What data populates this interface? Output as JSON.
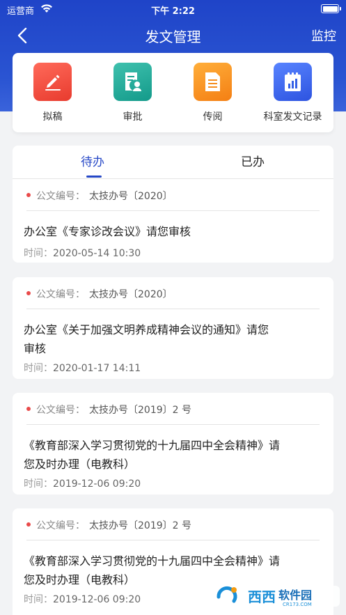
{
  "status_bar": {
    "carrier": "运营商",
    "time": "下午 2:22"
  },
  "nav": {
    "title": "发文管理",
    "right_action": "监控"
  },
  "actions": [
    {
      "label": "拟稿",
      "icon": "pencil-icon",
      "color": "#e83b2e"
    },
    {
      "label": "审批",
      "icon": "approval-icon",
      "color": "#139a8a"
    },
    {
      "label": "传阅",
      "icon": "document-icon",
      "color": "#f47f13"
    },
    {
      "label": "科室发文记录",
      "icon": "chart-record-icon",
      "color": "#2d53e0"
    }
  ],
  "tabs": {
    "pending": "待办",
    "done": "已办",
    "active": "pending"
  },
  "doc_labels": {
    "number_label": "公文编号：",
    "time_label": "时间："
  },
  "documents": [
    {
      "number": "太技办号〔2020〕",
      "title_line1": "办公室《专家诊改会议》请您审核",
      "title_line2": "",
      "time": "2020-05-14 10:30"
    },
    {
      "number": "太技办号〔2020〕",
      "title_line1": "办公室《关于加强文明养成精神会议的通知》请您",
      "title_line2": "审核",
      "time": "2020-01-17 14:11"
    },
    {
      "number": "太技办号〔2019〕2 号",
      "title_line1": "《教育部深入学习贯彻党的十九届四中全会精神》请",
      "title_line2": "您及时办理（电教科）",
      "time": "2019-12-06 09:20"
    },
    {
      "number": "太技办号〔2019〕2 号",
      "title_line1": "《教育部深入学习贯彻党的十九届四中全会精神》请",
      "title_line2": "您及时办理（电教科）",
      "time": "2019-12-06 09:20"
    }
  ],
  "watermark": {
    "text": "西西软件园",
    "sub": "CR173.COM"
  }
}
